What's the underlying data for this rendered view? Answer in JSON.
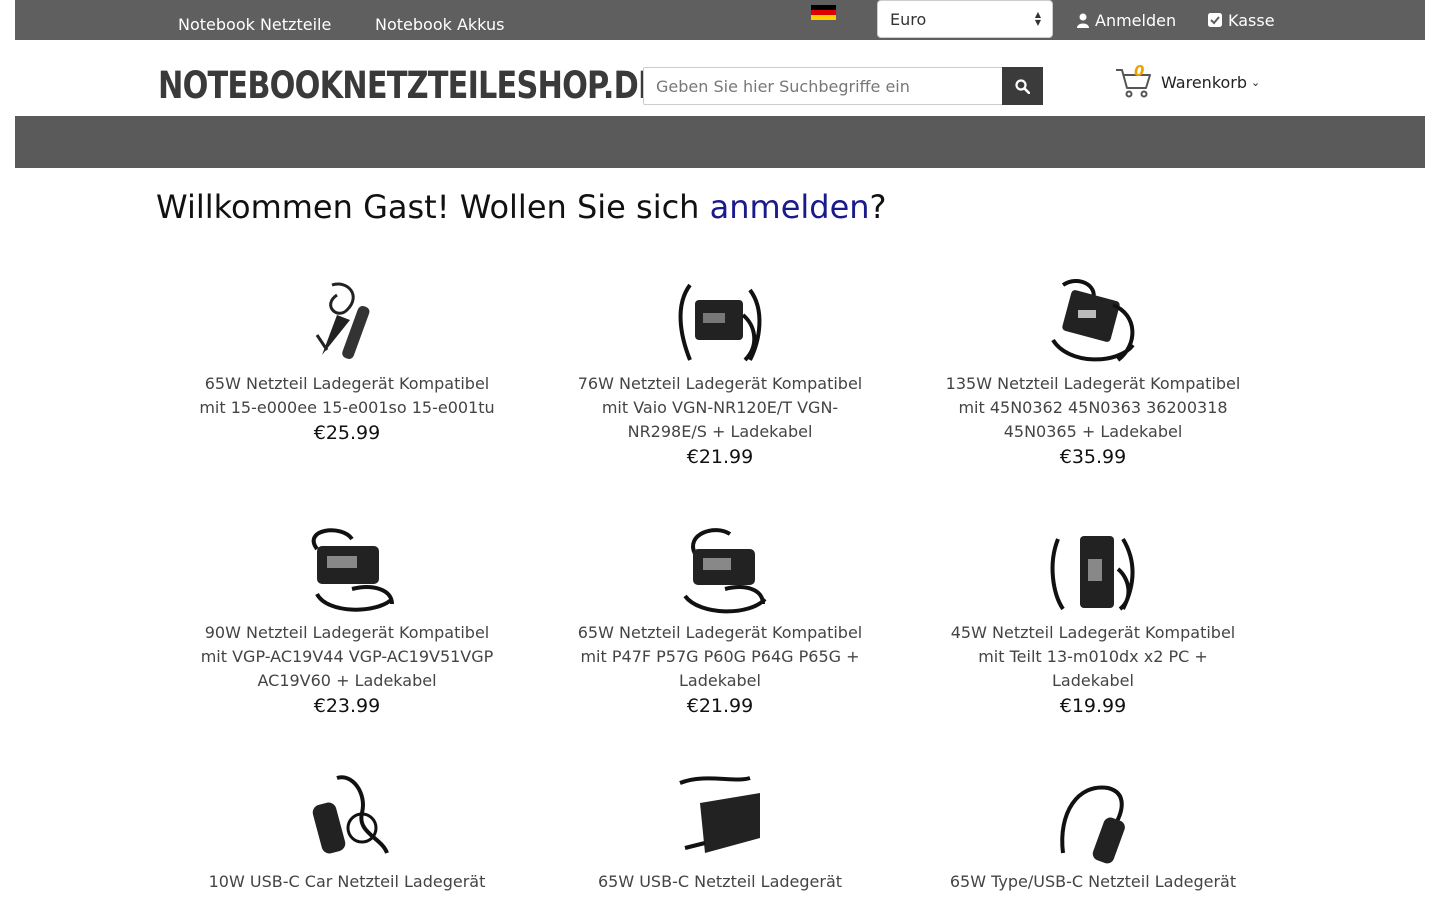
{
  "topbar": {
    "currency_selected": "Euro",
    "login_label": "Anmelden",
    "checkout_label": "Kasse"
  },
  "header": {
    "logo_text": "NOTEBOOKNETZTEILESHOP.DE",
    "search_placeholder": "Geben Sie hier Suchbegriffe ein",
    "cart_count": "0",
    "cart_label": "Warenkorb"
  },
  "nav": {
    "items": [
      {
        "label": "Notebook Netzteile"
      },
      {
        "label": "Notebook Akkus"
      }
    ]
  },
  "welcome": {
    "prefix": "Willkommen Gast! Wollen Sie sich ",
    "link": "anmelden",
    "suffix": "?"
  },
  "products": [
    {
      "name": "65W Netzteil Ladegerät Kompatibel mit 15-e000ee 15-e001so 15-e001tu",
      "price": "€25.99",
      "icon": "car-charger-image"
    },
    {
      "name": "76W Netzteil Ladegerät Kompatibel mit Vaio VGN-NR120E/T VGN-NR298E/S + Ladekabel",
      "price": "€21.99",
      "icon": "power-adapter-image"
    },
    {
      "name": "135W Netzteil Ladegerät Kompatibel mit 45N0362 45N0363 36200318 45N0365 + Ladekabel",
      "price": "€35.99",
      "icon": "power-adapter-image"
    },
    {
      "name": "90W Netzteil Ladegerät Kompatibel mit VGP-AC19V44 VGP-AC19V51VGP AC19V60 + Ladekabel",
      "price": "€23.99",
      "icon": "power-adapter-image"
    },
    {
      "name": "65W Netzteil Ladegerät Kompatibel mit P47F P57G P60G P64G P65G + Ladekabel",
      "price": "€21.99",
      "icon": "power-adapter-image"
    },
    {
      "name": "45W Netzteil Ladegerät Kompatibel mit Teilt 13-m010dx x2 PC + Ladekabel",
      "price": "€19.99",
      "icon": "power-adapter-image"
    },
    {
      "name": "10W USB-C Car Netzteil Ladegerät",
      "price": "",
      "icon": "car-charger-image"
    },
    {
      "name": "65W USB-C Netzteil Ladegerät",
      "price": "",
      "icon": "wall-charger-image"
    },
    {
      "name": "65W Type/USB-C Netzteil Ladegerät",
      "price": "",
      "icon": "car-charger-image"
    }
  ],
  "colors": {
    "topbar_bg": "#5f5f5f",
    "navbar_bg": "#5a5a5a",
    "link": "#1a1a8c",
    "cart_count": "#e9a300"
  }
}
